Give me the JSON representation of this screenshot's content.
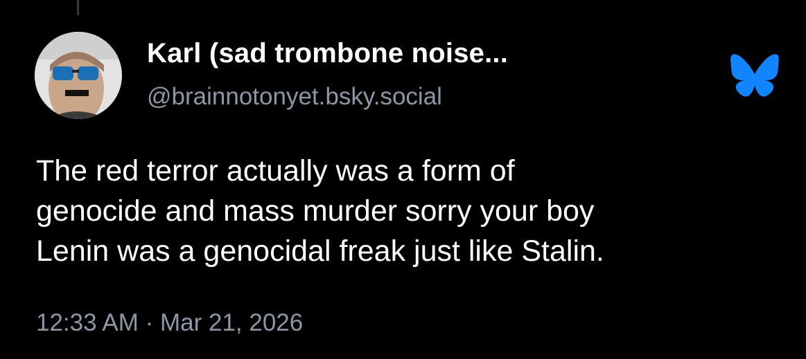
{
  "post": {
    "author": {
      "display_name": "Karl (sad trombone noise...",
      "handle": "@brainnotonyet.bsky.social",
      "avatar_icon": "avatar-photo"
    },
    "text_lines": [
      "The red terror actually was a form of",
      "genocide and mass murder sorry your boy",
      "Lenin was a genocidal freak just like Stalin."
    ],
    "timestamp": "12:33 AM · Mar 21, 2026",
    "platform_icon": "bluesky-butterfly-icon"
  },
  "colors": {
    "background": "#000000",
    "text_primary": "#ffffff",
    "text_secondary": "#8b98a5",
    "brand_blue": "#1185fe"
  }
}
